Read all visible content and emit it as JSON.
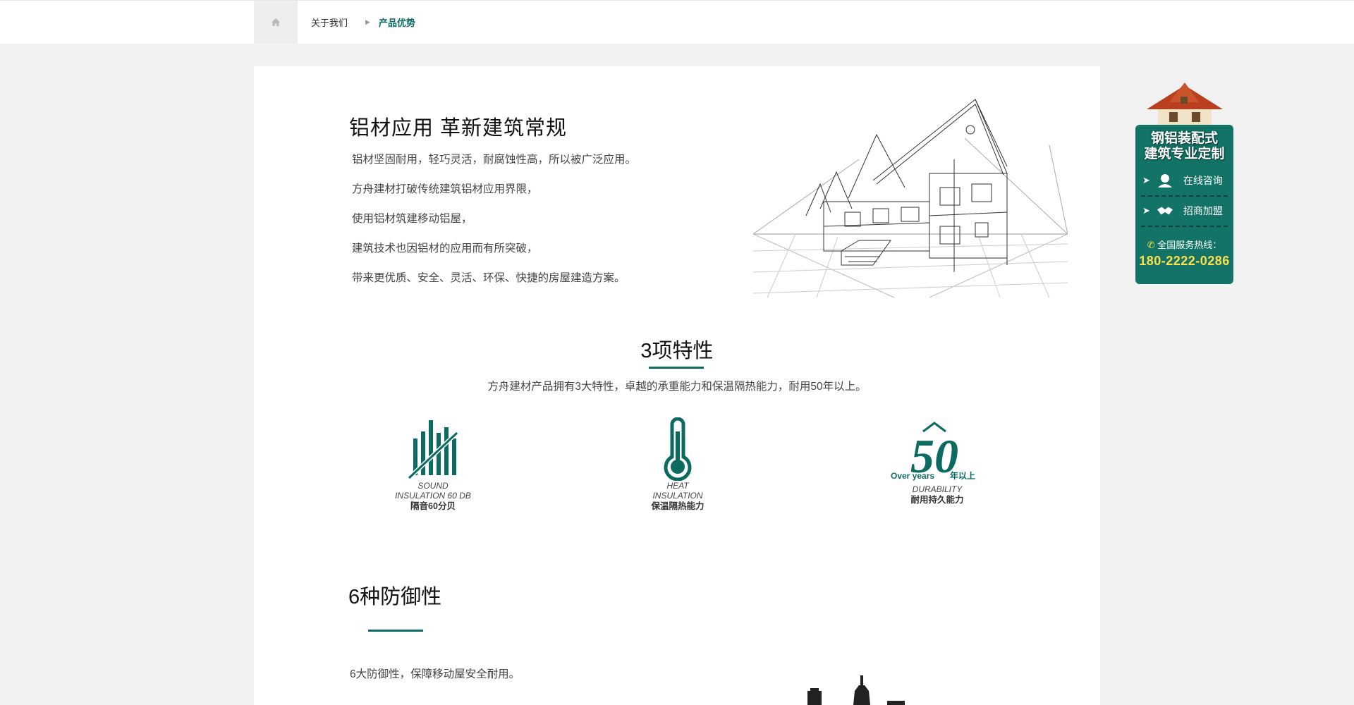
{
  "breadcrumb": {
    "home_icon": "home-icon",
    "items": [
      "关于我们",
      "产品优势"
    ],
    "separator_icon": "triangle-right-icon"
  },
  "intro": {
    "title": "铝材应用  革新建筑常规",
    "lines": [
      "铝材坚固耐用，轻巧灵活，耐腐蚀性高，所以被广泛应用。",
      "方舟建材打破传统建筑铝材应用界限，",
      "使用铝材筑建移动铝屋，",
      "建筑技术也因铝材的应用而有所突破，",
      "带来更优质、安全、灵活、环保、快捷的房屋建造方案。"
    ],
    "image": "house-sketch-illustration"
  },
  "features": {
    "title": "3项特性",
    "description": "方舟建材产品拥有3大特性，卓越的承重能力和保温隔热能力，耐用50年以上。",
    "items": [
      {
        "icon": "sound-insulation-icon",
        "en": "SOUND\nINSULATION 60 DB",
        "cn": "隔音60分贝"
      },
      {
        "icon": "thermometer-icon",
        "en": "HEAT\nINSULATION",
        "cn": "保温隔热能力"
      },
      {
        "icon": "fifty-years-icon",
        "icon_number": "50",
        "icon_en": "Over  years",
        "icon_cn": "年以上",
        "en": "DURABILITY",
        "cn": "耐用持久能力"
      }
    ]
  },
  "defense": {
    "title": "6种防御性",
    "description": "6大防御性，保障移动屋安全耐用。"
  },
  "side_widget": {
    "banner_line1": "钢铝装配式",
    "banner_line2": "建筑专业定制",
    "items": [
      {
        "label": "在线咨询",
        "icon": "consultant-icon"
      },
      {
        "label": "招商加盟",
        "icon": "handshake-icon"
      }
    ],
    "hotline_label": "全国服务热线：",
    "hotline_number": "180-2222-0286",
    "colors": {
      "background": "#127366",
      "number": "#ffe04a"
    }
  },
  "colors": {
    "accent": "#0b6b61",
    "page_bg": "#f2f2f2"
  }
}
